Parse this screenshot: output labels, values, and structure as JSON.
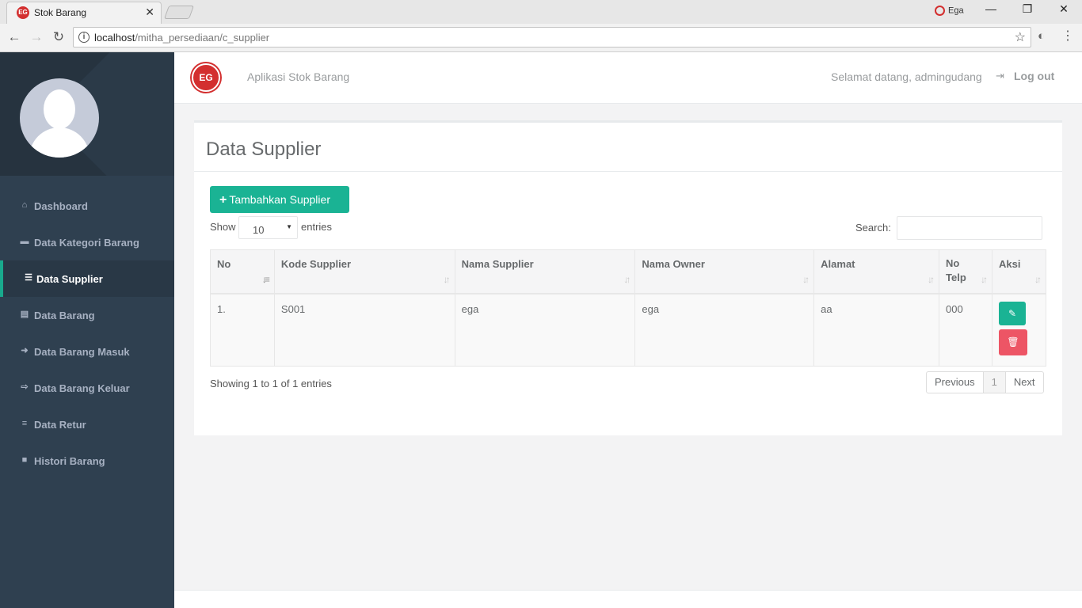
{
  "browser": {
    "tab_title": "Stok Barang",
    "favicon_text": "EG",
    "profile_name": "Ega",
    "url_host": "localhost",
    "url_path": "/mitha_persediaan/c_supplier"
  },
  "header": {
    "app_title": "Aplikasi Stok Barang",
    "logo_text": "EG",
    "welcome": "Selamat datang, admingudang",
    "logout": "Log out"
  },
  "sidebar": {
    "items": [
      {
        "label": "Dashboard",
        "icon": "home-icon"
      },
      {
        "label": "Data Kategori Barang",
        "icon": "briefcase-icon"
      },
      {
        "label": "Data Supplier",
        "icon": "database-icon",
        "active": true
      },
      {
        "label": "Data Barang",
        "icon": "file-icon"
      },
      {
        "label": "Data Barang Masuk",
        "icon": "sign-in-icon"
      },
      {
        "label": "Data Barang Keluar",
        "icon": "sign-out-icon"
      },
      {
        "label": "Data Retur",
        "icon": "bars-icon"
      },
      {
        "label": "Histori Barang",
        "icon": "folder-icon"
      }
    ]
  },
  "page": {
    "title": "Data Supplier",
    "add_button": "Tambahkan Supplier",
    "show_label": "Show",
    "entries_value": "10",
    "entries_label": "entries",
    "search_label": "Search:",
    "search_value": "",
    "showing_text": "Showing 1 to 1 of 1 entries",
    "pagination": {
      "previous": "Previous",
      "current": "1",
      "next": "Next"
    }
  },
  "table": {
    "columns": [
      "No",
      "Kode Supplier",
      "Nama Supplier",
      "Nama Owner",
      "Alamat",
      "No Telp",
      "Aksi"
    ],
    "rows": [
      [
        "1.",
        "S001",
        "ega",
        "ega",
        "aa",
        "000"
      ]
    ]
  },
  "colors": {
    "sidebar_bg": "#2f4050",
    "accent": "#1ab394",
    "danger": "#ed5565",
    "brand_red": "#d32f2f"
  }
}
